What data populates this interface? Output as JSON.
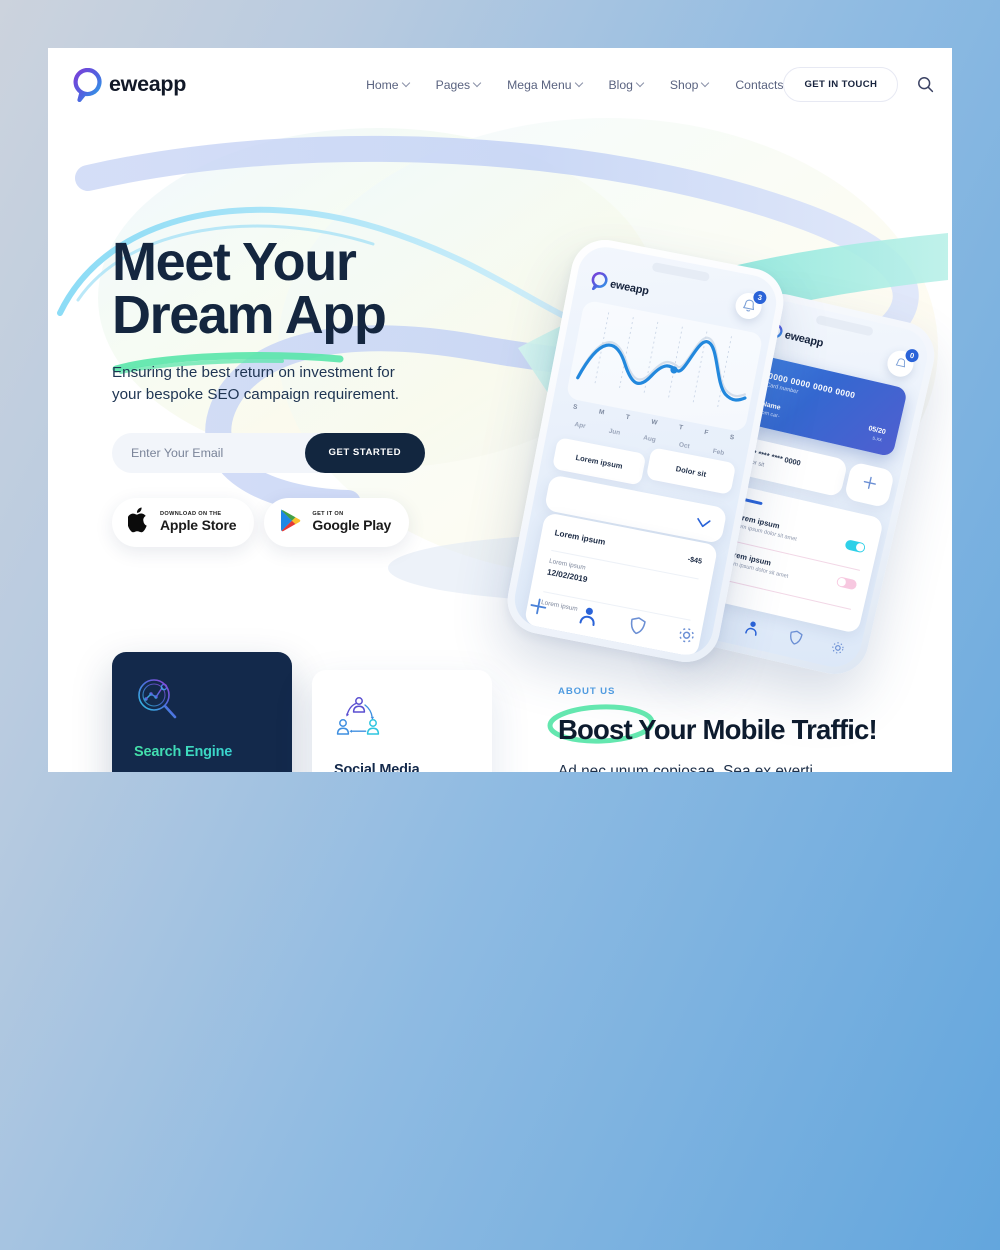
{
  "theme": {
    "page_bg_from": "#ccd3dd",
    "page_bg_to": "#63a6dd",
    "panel_bg": "#ffffff",
    "dark_navy": "#13294b",
    "accent_blue": "#2a63d8",
    "accent_mint": "#45e0a8",
    "eyebrow_blue": "#4f9be0"
  },
  "nav": {
    "logo": {
      "mark_icon": "eweapp-pin-logo-icon",
      "text": "eweapp"
    },
    "items": [
      {
        "label": "Home",
        "has_dropdown": true
      },
      {
        "label": "Pages",
        "has_dropdown": true
      },
      {
        "label": "Mega Menu",
        "has_dropdown": true
      },
      {
        "label": "Blog",
        "has_dropdown": true
      },
      {
        "label": "Shop",
        "has_dropdown": true
      },
      {
        "label": "Contacts",
        "has_dropdown": false
      }
    ],
    "cta_label": "GET IN TOUCH",
    "search_icon": "search-icon",
    "menu_icon": "hamburger-menu-icon"
  },
  "hero": {
    "title_line1": "Meet Your",
    "title_line2": "Dream App",
    "subtitle_line1": "Ensuring the best return on investment for",
    "subtitle_line2": "your bespoke SEO campaign requirement.",
    "email_placeholder": "Enter Your Email",
    "email_value": "",
    "submit_label": "GET STARTED",
    "stores": [
      {
        "icon": "apple-logo-icon",
        "small": "DOWNLOAD ON THE",
        "big": "Apple Store"
      },
      {
        "icon": "google-play-icon",
        "small": "GET IT ON",
        "big": "Google Play"
      }
    ]
  },
  "phone_a": {
    "logo_text": "eweapp",
    "bell_icon": "bell-icon",
    "badge_count": "3",
    "chart": {
      "weekday_labels": [
        "S",
        "M",
        "T",
        "W",
        "T",
        "F",
        "S"
      ],
      "month_labels": [
        "Apr",
        "Jun",
        "Aug",
        "Oct",
        "Feb"
      ]
    },
    "tiles": [
      "Lorem ipsum",
      "Dolor sit"
    ],
    "check_icon": "chevron-check-icon",
    "list": [
      {
        "title": "Lorem ipsum",
        "amount": "-$45"
      },
      {
        "title": "Lorem ipsum",
        "sub": "12/02/2019"
      },
      {
        "title": "Lorem ipsum",
        "sub": ""
      }
    ],
    "tabs": [
      "plus-icon",
      "person-icon",
      "shield-icon",
      "gear-icon"
    ]
  },
  "phone_b": {
    "logo_text": "eweapp",
    "bell_icon": "bell-icon",
    "badge_count": "0",
    "card": {
      "number": "0000 0000 0000 0000",
      "number_label": "Card number",
      "name_label": "Name",
      "name_value": "rom car-",
      "expiry_value": "05/20",
      "expiry_label": "s.xx"
    },
    "row": {
      "masked": "**** **** **** 0000",
      "sub": "Dolor sit",
      "add_icon": "plus-icon"
    },
    "settings": [
      {
        "title": "Lorem ipsum",
        "sub": "Lorem ipsum dolor sit amet",
        "toggle_on": true
      },
      {
        "title": "Lorem ipsum",
        "sub": "Lorem ipsum dolor sit amet",
        "toggle_on": false
      }
    ],
    "tabs": [
      "plus-icon",
      "person-icon",
      "shield-icon",
      "gear-icon"
    ]
  },
  "service_cards": [
    {
      "icon": "search-analytics-icon",
      "title": "Search Engine",
      "theme": "dark"
    },
    {
      "icon": "social-network-icon",
      "title": "Social Media",
      "theme": "light"
    }
  ],
  "about": {
    "eyebrow": "ABOUT US",
    "title_highlight": "Boost",
    "title_rest": " Your Mobile Traffic!",
    "body": "Ad nec unum copiosae. Sea ex everti"
  }
}
